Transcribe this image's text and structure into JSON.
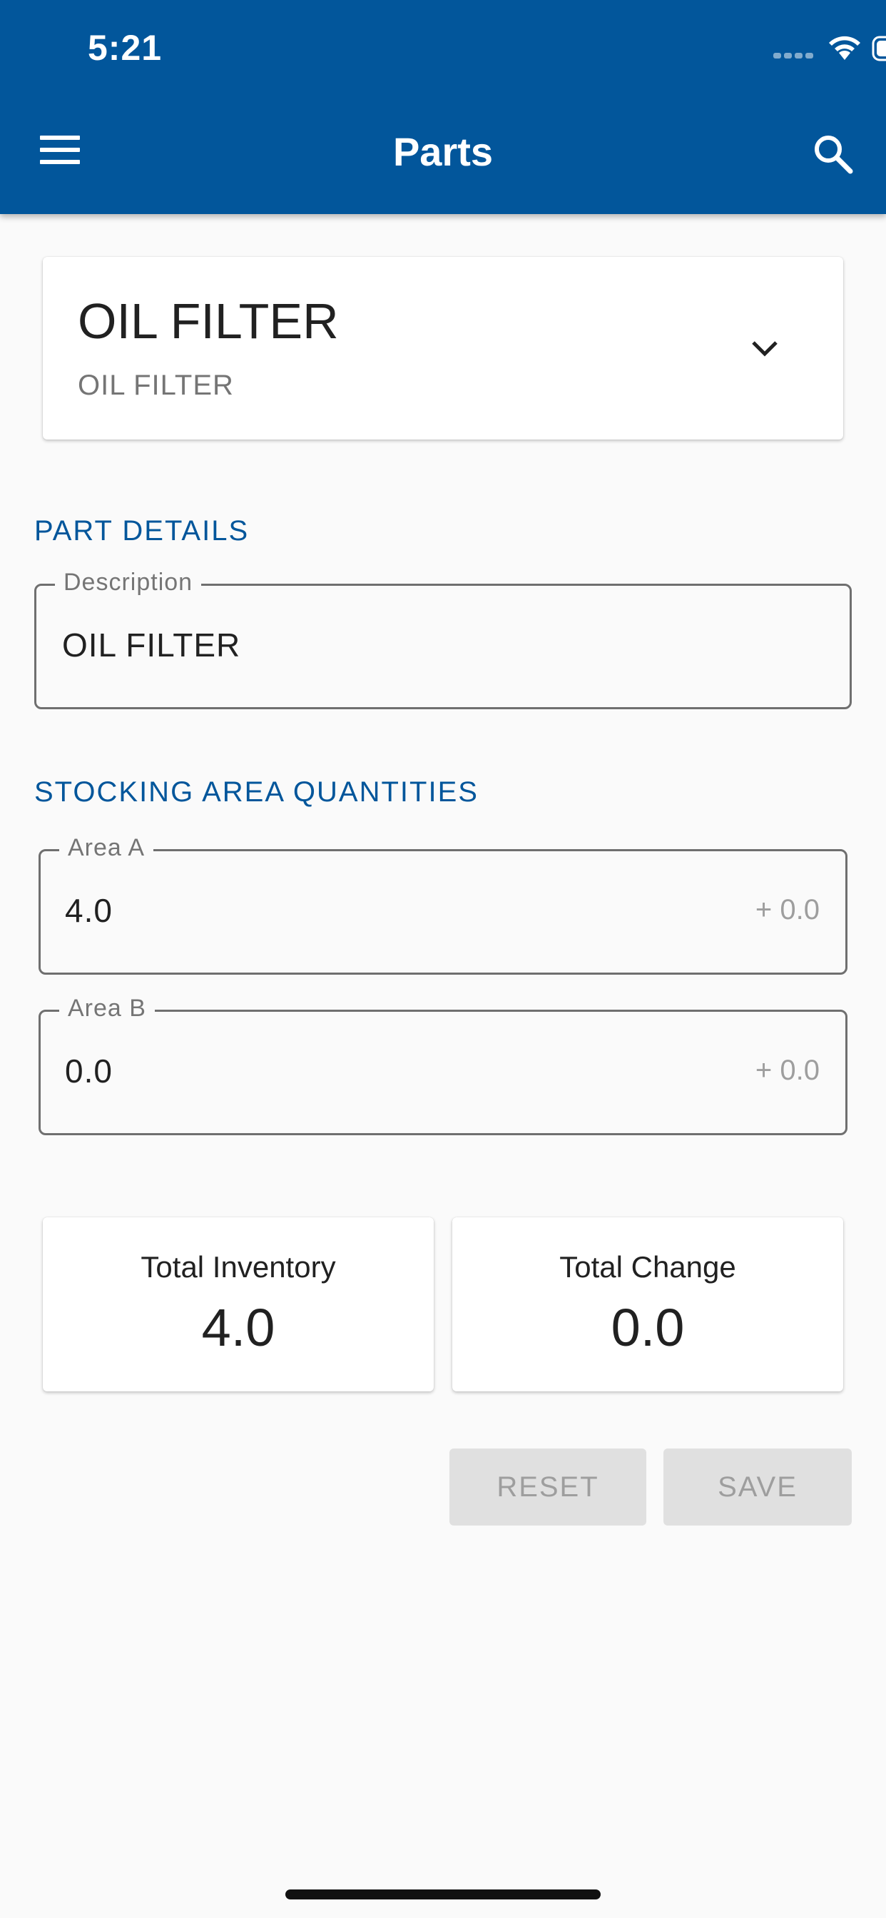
{
  "status_bar": {
    "time": "5:21"
  },
  "app_bar": {
    "title": "Parts",
    "left_icon": "menu-icon",
    "right_icon": "search-icon",
    "color": "#02569b"
  },
  "part_selector": {
    "title": "OIL FILTER",
    "subtitle": "OIL FILTER",
    "icon": "chevron-down-icon"
  },
  "part_details": {
    "header": "PART DETAILS",
    "description": {
      "label": "Description",
      "value": "OIL FILTER"
    }
  },
  "stocking_areas": {
    "header": "STOCKING AREA QUANTITIES",
    "areas": [
      {
        "label": "Area A",
        "value": "4.0",
        "change": "+ 0.0"
      },
      {
        "label": "Area B",
        "value": "0.0",
        "change": "+ 0.0"
      }
    ]
  },
  "totals": {
    "inventory": {
      "label": "Total Inventory",
      "value": "4.0"
    },
    "change": {
      "label": "Total Change",
      "value": "0.0"
    }
  },
  "actions": {
    "reset": "RESET",
    "save": "SAVE"
  }
}
